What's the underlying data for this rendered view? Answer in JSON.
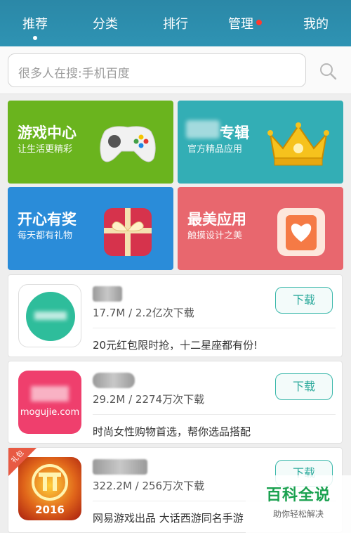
{
  "nav": {
    "tabs": [
      {
        "label": "推荐",
        "active": true
      },
      {
        "label": "分类"
      },
      {
        "label": "排行"
      },
      {
        "label": "管理",
        "badge": true
      },
      {
        "label": "我的"
      }
    ]
  },
  "search": {
    "placeholder": "很多人在搜:手机百度"
  },
  "tiles": [
    {
      "title": "游戏中心",
      "subtitle": "让生活更精彩",
      "color": "#6ab41e",
      "icon": "gamepad-icon"
    },
    {
      "title": "专辑",
      "subtitle": "官方精品应用",
      "color": "#33aeb5",
      "icon": "crown-icon"
    },
    {
      "title": "开心有奖",
      "subtitle": "每天都有礼物",
      "color": "#2a8cd9",
      "icon": "gift-icon"
    },
    {
      "title": "最美应用",
      "subtitle": "触摸设计之美",
      "color": "#e8676e",
      "icon": "heart-card-icon"
    }
  ],
  "apps": [
    {
      "meta": "17.7M / 2.2亿次下载",
      "desc": "20元红包限时抢，十二星座都有份!",
      "button": "下载",
      "icon": "app-icon-green-circle"
    },
    {
      "meta": "29.2M / 2274万次下载",
      "desc": "时尚女性购物首选，帮你选品搭配",
      "button": "下载",
      "icon": "app-icon-mogujie",
      "icon_text": "mogujie.com"
    },
    {
      "meta": "322.2M / 256万次下载",
      "desc": "网易游戏出品 大话西游同名手游",
      "button": "下载",
      "icon": "app-icon-xiyou",
      "corner": "礼包",
      "icon_text": "2016"
    }
  ],
  "watermark": {
    "title": "百科全说",
    "subtitle": "助你轻松解决"
  }
}
